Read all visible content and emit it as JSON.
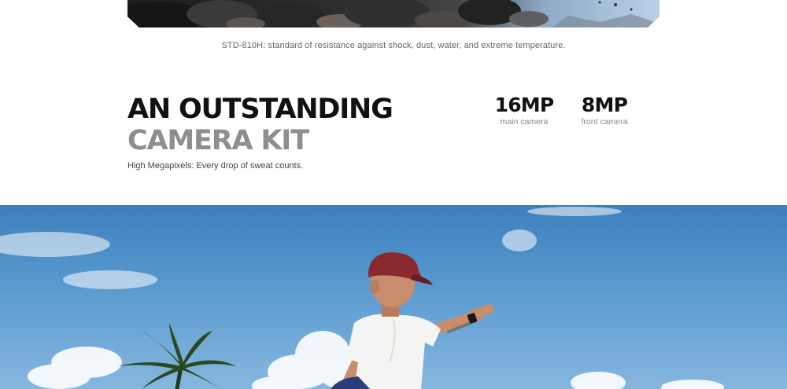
{
  "durability": {
    "caption": "STD-810H: standard of resistance against shock, dust, water, and extreme temperature."
  },
  "camera_kit": {
    "headline_line1": "AN OUTSTANDING",
    "headline_line2": "CAMERA KIT",
    "subline": "High Megapixels: Every drop of sweat counts.",
    "stats": [
      {
        "value": "16MP",
        "label": "main camera"
      },
      {
        "value": "8MP",
        "label": "front camera"
      }
    ]
  },
  "colors": {
    "headline_primary": "#111111",
    "headline_secondary": "#8e8e8e",
    "sky": "#5a9ad0"
  }
}
